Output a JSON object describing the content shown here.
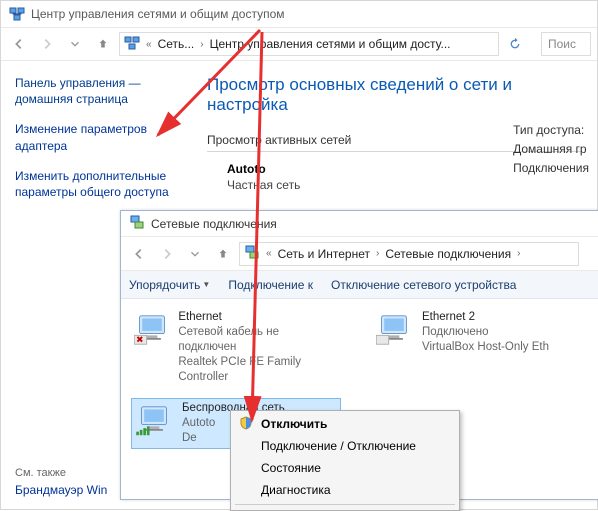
{
  "window1": {
    "title": "Центр управления сетями и общим доступом",
    "breadcrumb": {
      "part1": "Сеть...",
      "part2": "Центр управления сетями и общим досту..."
    },
    "search_placeholder": "Поис"
  },
  "sidebar": {
    "home_link": "Панель управления — домашняя страница",
    "adapter_link": "Изменение параметров адаптера",
    "sharing_link": "Изменить дополнительные параметры общего доступа",
    "see_also": "См. также",
    "firewall": "Брандмауэр Win"
  },
  "main": {
    "heading": "Просмотр основных сведений о сети и настройка",
    "active_label": "Просмотр активных сетей",
    "net_name": "Autoto",
    "net_type": "Частная сеть",
    "right": {
      "l1": "Тип доступа:",
      "l2": "Домашняя гр",
      "l3": "Подключения"
    }
  },
  "window2": {
    "title": "Сетевые подключения",
    "breadcrumb": {
      "part1": "Сеть и Интернет",
      "part2": "Сетевые подключения"
    },
    "toolbar": {
      "organize": "Упорядочить",
      "connect": "Подключение к",
      "disable": "Отключение сетевого устройства"
    },
    "connections": [
      {
        "name": "Ethernet",
        "status": "Сетевой кабель не подключен",
        "device": "Realtek PCIe FE Family Controller",
        "disabled_cross": true
      },
      {
        "name": "Ethernet 2",
        "status": "Подключено",
        "device": "VirtualBox Host-Only Eth"
      },
      {
        "name": "Беспроводная сеть",
        "status": "Autoto",
        "device": "De",
        "selected": true
      }
    ]
  },
  "contextmenu": {
    "disable": "Отключить",
    "toggle": "Подключение / Отключение",
    "status": "Состояние",
    "diag": "Диагностика"
  }
}
